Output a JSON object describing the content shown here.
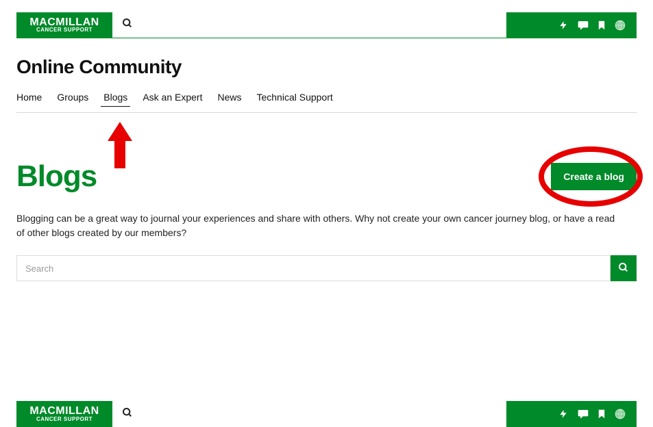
{
  "brand": {
    "main": "MACMILLAN",
    "sub": "CANCER SUPPORT"
  },
  "site_title": "Online Community",
  "nav": {
    "items": [
      {
        "label": "Home"
      },
      {
        "label": "Groups"
      },
      {
        "label": "Blogs",
        "active": true
      },
      {
        "label": "Ask an Expert"
      },
      {
        "label": "News"
      },
      {
        "label": "Technical Support"
      }
    ]
  },
  "page": {
    "heading": "Blogs",
    "cta_label": "Create a blog",
    "intro": "Blogging can be a great way to journal your experiences and share with others. Why not create your own cancer journey blog, or have a read of other blogs created by our members?"
  },
  "search": {
    "placeholder": "Search"
  },
  "colors": {
    "brand_green": "#008a29",
    "annotation_red": "#e60000"
  }
}
